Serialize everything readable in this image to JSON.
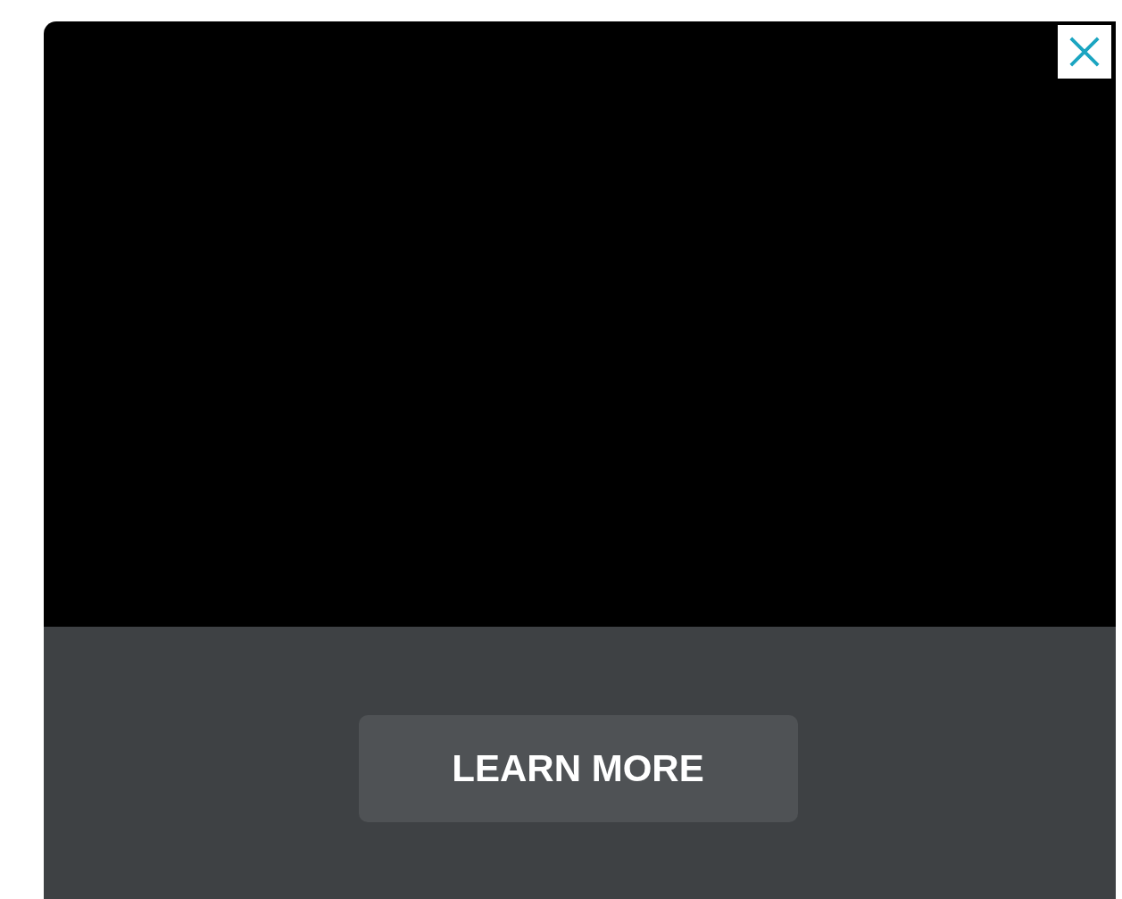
{
  "ad": {
    "cta_button": {
      "label": "LEARN MORE"
    }
  }
}
